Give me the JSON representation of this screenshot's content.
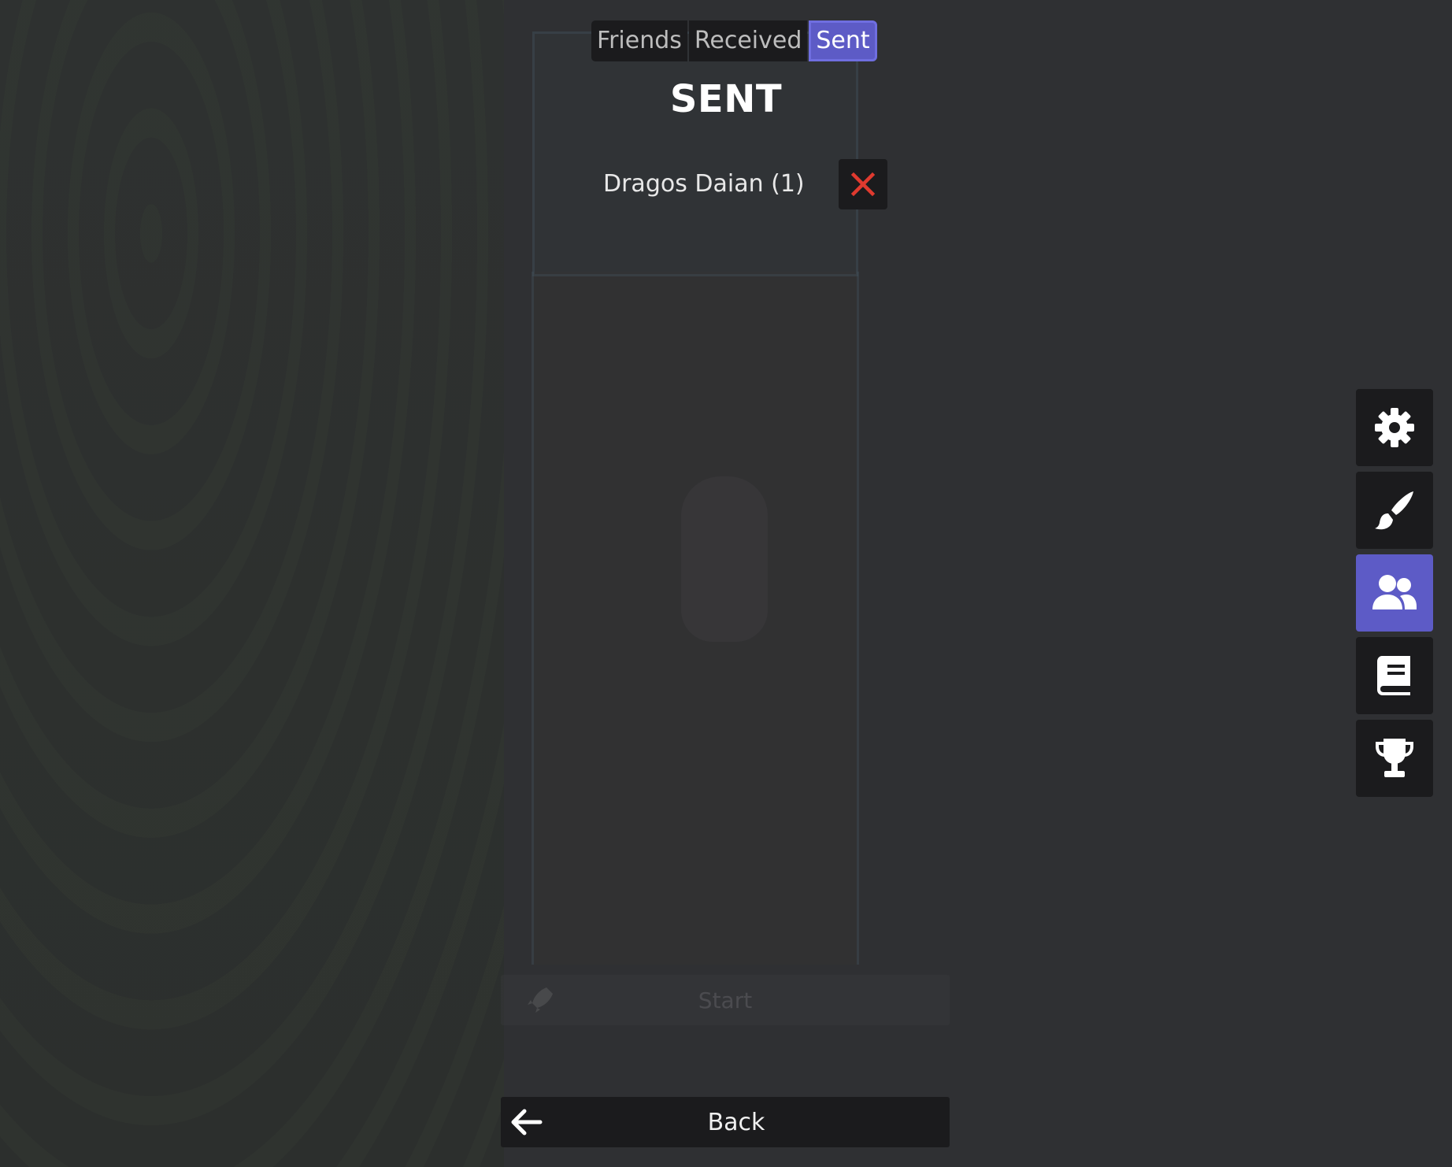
{
  "tabs": [
    {
      "label": "Friends",
      "active": false
    },
    {
      "label": "Received",
      "active": false
    },
    {
      "label": "Sent",
      "active": true
    }
  ],
  "section_title": "SENT",
  "sent_requests": [
    {
      "name": "Dragos Daian (1)"
    }
  ],
  "side_menu": {
    "items": [
      {
        "icon": "gear-icon",
        "active": false
      },
      {
        "icon": "paintbrush-icon",
        "active": false
      },
      {
        "icon": "users-icon",
        "active": true
      },
      {
        "icon": "book-icon",
        "active": false
      },
      {
        "icon": "trophy-icon",
        "active": false
      }
    ]
  },
  "background": {
    "start_label": "Start"
  },
  "back_button": {
    "label": "Back"
  },
  "colors": {
    "accent": "#5d5bc6",
    "button_bg": "#1b1b1d",
    "cancel_x": "#e03a2f",
    "overlay_bg": "#2f3033"
  }
}
